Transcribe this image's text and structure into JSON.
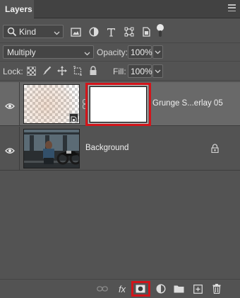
{
  "panel": {
    "tab_label": "Layers",
    "menu_icon": "panel-menu-icon"
  },
  "filter": {
    "kind_label": "Kind",
    "kind_icon": "search-icon",
    "icons": [
      "pixel-layer-filter-icon",
      "adjustment-layer-filter-icon",
      "type-layer-filter-icon",
      "shape-layer-filter-icon",
      "smart-object-filter-icon"
    ],
    "toggle_on": true
  },
  "blend": {
    "mode": "Multiply",
    "opacity_label": "Opacity:",
    "opacity_value": "100%"
  },
  "lock": {
    "label": "Lock:",
    "icons": [
      "lock-transparent-pixels-icon",
      "lock-image-pixels-icon",
      "lock-position-icon",
      "prevent-auto-nesting-icon",
      "lock-all-icon"
    ],
    "fill_label": "Fill:",
    "fill_value": "100%"
  },
  "layers": [
    {
      "name": "Grunge S...erlay 05",
      "visible": true,
      "selected": true,
      "smart_object": true,
      "has_mask": true
    },
    {
      "name": "Background",
      "visible": true,
      "selected": false,
      "locked": true
    }
  ],
  "footer": {
    "buttons": [
      "link-layers-icon",
      "layer-effects-icon",
      "add-layer-mask-icon",
      "new-adjustment-layer-icon",
      "new-group-icon",
      "new-layer-icon",
      "delete-layer-icon"
    ],
    "fx_label": "fx"
  },
  "colors": {
    "highlight": "#d2141a",
    "panel_bg": "#535353",
    "selected_row": "#696969"
  }
}
